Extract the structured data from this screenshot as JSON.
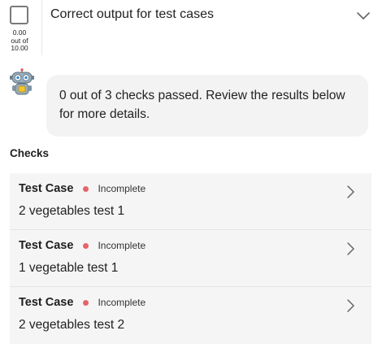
{
  "rubric": {
    "score_value": "0.00",
    "score_out_of": "out of",
    "score_max": "10.00",
    "title": "Correct output for test cases"
  },
  "message": {
    "avatar_icon": "robot-icon",
    "text": "0 out of 3 checks passed. Review the results below for more details."
  },
  "checks": {
    "heading": "Checks",
    "status_color": "#e5646a",
    "items": [
      {
        "title": "Test Case",
        "status": "Incomplete",
        "description": "2 vegetables test 1"
      },
      {
        "title": "Test Case",
        "status": "Incomplete",
        "description": "1 vegetable test 1"
      },
      {
        "title": "Test Case",
        "status": "Incomplete",
        "description": "2 vegetables test 2"
      }
    ]
  }
}
